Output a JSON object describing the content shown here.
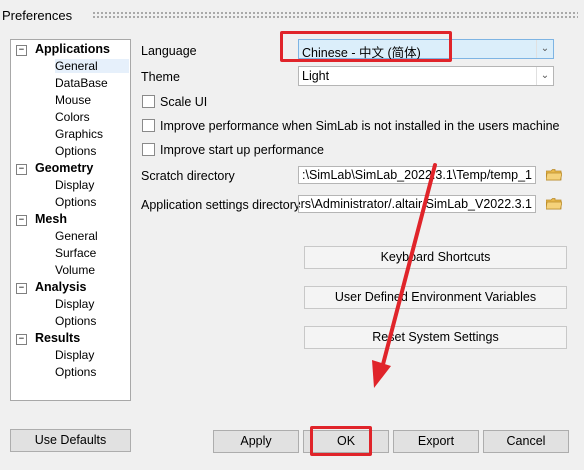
{
  "window": {
    "title": "Preferences"
  },
  "tree": {
    "groups": [
      {
        "label": "Applications",
        "toggle": "−",
        "children": [
          "General",
          "DataBase",
          "Mouse",
          "Colors",
          "Graphics",
          "Options"
        ]
      },
      {
        "label": "Geometry",
        "toggle": "−",
        "children": [
          "Display",
          "Options"
        ]
      },
      {
        "label": "Mesh",
        "toggle": "−",
        "children": [
          "General",
          "Surface",
          "Volume"
        ]
      },
      {
        "label": "Analysis",
        "toggle": "−",
        "children": [
          "Display",
          "Options"
        ]
      },
      {
        "label": "Results",
        "toggle": "−",
        "children": [
          "Display",
          "Options"
        ]
      }
    ],
    "selected": "General"
  },
  "form": {
    "language_label": "Language",
    "language_value": "Chinese - 中文 (简体)",
    "theme_label": "Theme",
    "theme_value": "Light",
    "scale_ui": "Scale UI",
    "improve_perf": "Improve performance when SimLab is not installed in the users machine",
    "improve_startup": "Improve start up performance",
    "scratch_label": "Scratch directory",
    "scratch_value": ":\\SimLab\\SimLab_2022.3.1\\Temp/temp_1",
    "appsettings_label": "Application settings directory",
    "appsettings_value": "ers\\Administrator/.altair/SimLab_V2022.3.1"
  },
  "buttons": {
    "keyboard_shortcuts": "Keyboard Shortcuts",
    "user_env_vars": "User Defined Environment Variables",
    "reset_settings": "Reset System Settings",
    "use_defaults": "Use Defaults",
    "apply": "Apply",
    "ok": "OK",
    "export": "Export",
    "cancel": "Cancel"
  },
  "colors": {
    "annotation_red": "#e0242a",
    "selection_bg": "#e6f0fb"
  },
  "icons": {
    "folder": "folder-icon",
    "dropdown": "chevron-down-icon"
  }
}
